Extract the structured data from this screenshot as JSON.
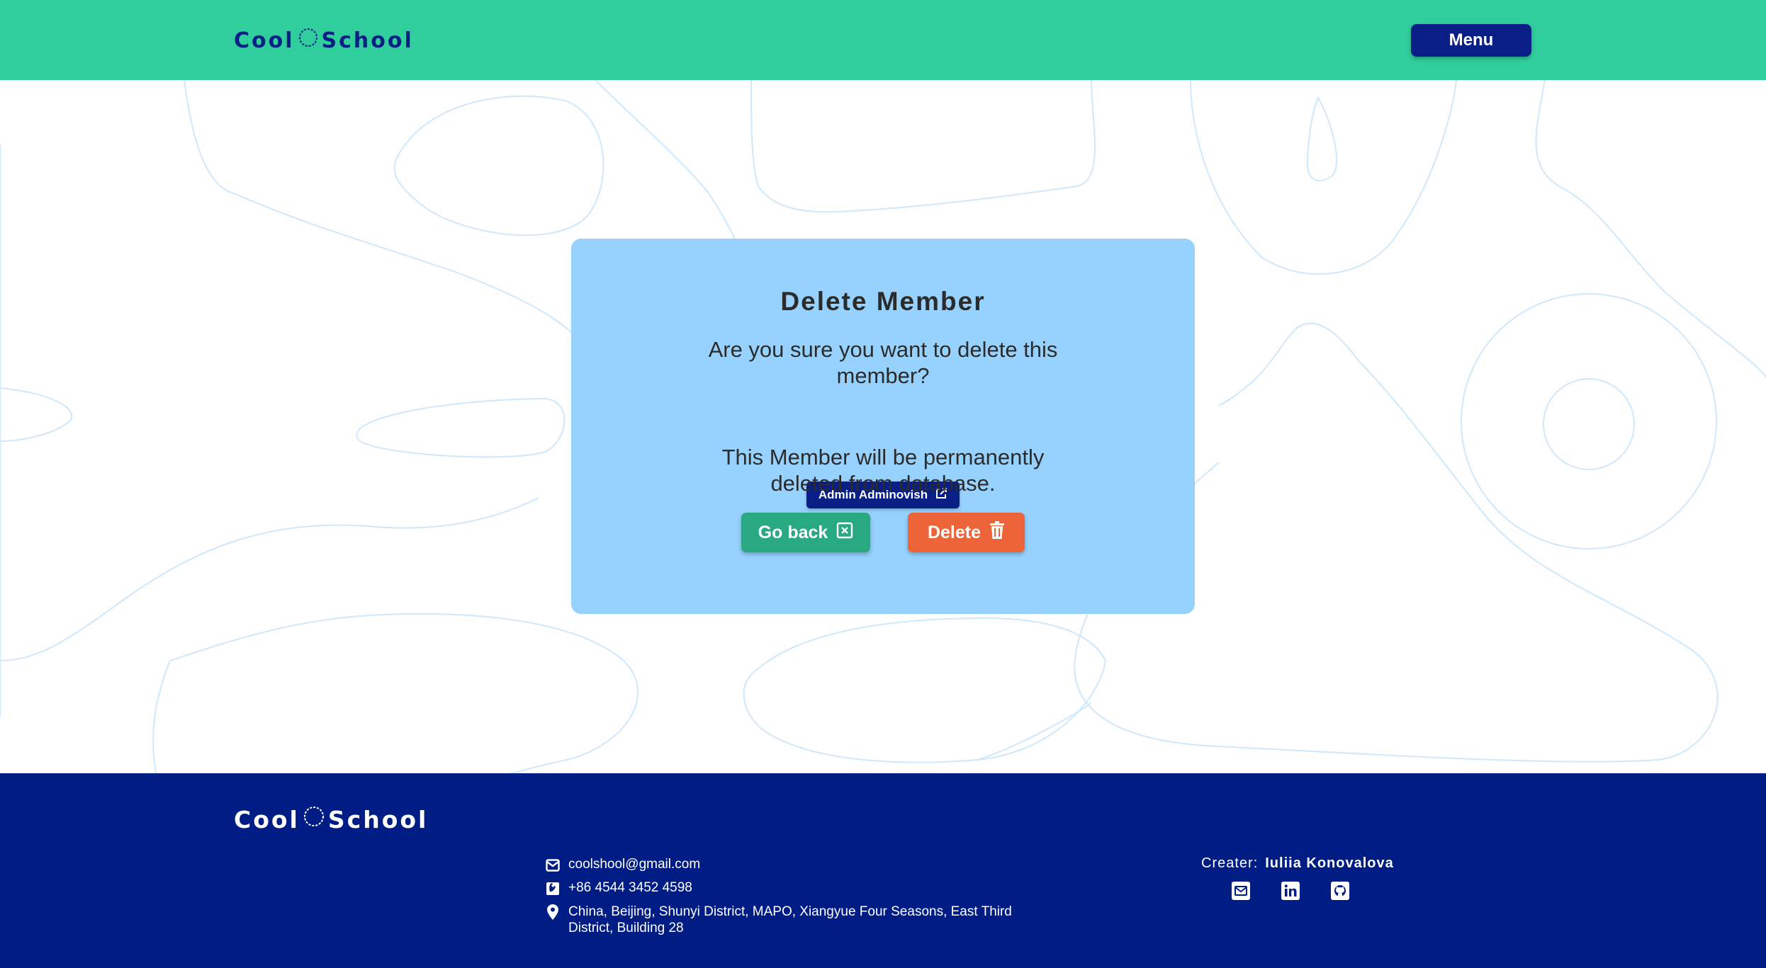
{
  "header": {
    "logo_left": "Cool",
    "logo_right": "School",
    "menu_label": "Menu"
  },
  "dialog": {
    "title": "Delete Member",
    "question": "Are you sure you want to delete this member?",
    "member_name": "Admin Adminovish",
    "warning": "This Member will be permanently deleted from database.",
    "go_back_label": "Go back",
    "delete_label": "Delete"
  },
  "footer": {
    "logo_left": "Cool",
    "logo_right": "School",
    "email": "coolshool@gmail.com",
    "phone": "+86 4544 3452 4598",
    "address": "China, Beijing, Shunyi District, MAPO, Xiangyue Four Seasons, East Third District, Building 28",
    "creator_label": "Creater:",
    "creator_name": "Iuliia Konovalova",
    "social_icons": [
      "mail-icon",
      "linkedin-icon",
      "github-icon"
    ]
  },
  "colors": {
    "header_bg": "#30ce9c",
    "brand_navy": "#0a1f86",
    "footer_bg": "#001d86",
    "card_bg": "#96d2fd",
    "go_back_bg": "#29a982",
    "delete_bg": "#ec6437"
  }
}
